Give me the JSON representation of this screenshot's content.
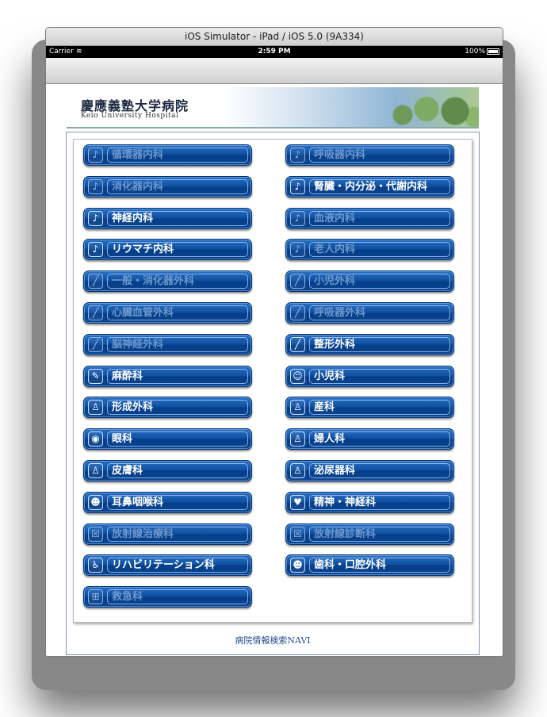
{
  "window": {
    "title": "iOS Simulator - iPad / iOS 5.0 (9A334)"
  },
  "statusbar": {
    "carrier": "Carrier",
    "time": "2:59 PM",
    "battery": "100%"
  },
  "logo": {
    "jp": "慶應義塾大学病院",
    "en": "Keio University Hospital"
  },
  "buttons": [
    {
      "label": "循環器内科",
      "icon": "stethoscope-icon",
      "glyph": "♪",
      "active": false
    },
    {
      "label": "呼吸器内科",
      "icon": "stethoscope-icon",
      "glyph": "♪",
      "active": false
    },
    {
      "label": "消化器内科",
      "icon": "stethoscope-icon",
      "glyph": "♪",
      "active": false
    },
    {
      "label": "腎臓・内分泌・代謝内科",
      "icon": "stethoscope-icon",
      "glyph": "♪",
      "active": true
    },
    {
      "label": "神経内科",
      "icon": "stethoscope-icon",
      "glyph": "♪",
      "active": true
    },
    {
      "label": "血液内科",
      "icon": "stethoscope-icon",
      "glyph": "♪",
      "active": false
    },
    {
      "label": "リウマチ内科",
      "icon": "stethoscope-icon",
      "glyph": "♪",
      "active": true
    },
    {
      "label": "老人内科",
      "icon": "stethoscope-icon",
      "glyph": "♪",
      "active": false
    },
    {
      "label": "一般・消化器外科",
      "icon": "scalpel-icon",
      "glyph": "╱",
      "active": false
    },
    {
      "label": "小児外科",
      "icon": "scalpel-icon",
      "glyph": "╱",
      "active": false
    },
    {
      "label": "心臓血管外科",
      "icon": "scalpel-icon",
      "glyph": "╱",
      "active": false
    },
    {
      "label": "呼吸器外科",
      "icon": "scalpel-icon",
      "glyph": "╱",
      "active": false
    },
    {
      "label": "脳神経外科",
      "icon": "scalpel-icon",
      "glyph": "╱",
      "active": false
    },
    {
      "label": "整形外科",
      "icon": "scalpel-icon",
      "glyph": "╱",
      "active": true
    },
    {
      "label": "麻酔科",
      "icon": "syringe-icon",
      "glyph": "✎",
      "active": true
    },
    {
      "label": "小児科",
      "icon": "parent-child-icon",
      "glyph": "☺",
      "active": true
    },
    {
      "label": "形成外科",
      "icon": "person-icon",
      "glyph": "♙",
      "active": true
    },
    {
      "label": "産科",
      "icon": "pregnant-woman-icon",
      "glyph": "♙",
      "active": true
    },
    {
      "label": "眼科",
      "icon": "eye-face-icon",
      "glyph": "◉",
      "active": true
    },
    {
      "label": "婦人科",
      "icon": "woman-icon",
      "glyph": "♙",
      "active": true
    },
    {
      "label": "皮膚科",
      "icon": "person-icon",
      "glyph": "♙",
      "active": true
    },
    {
      "label": "泌尿器科",
      "icon": "person-icon",
      "glyph": "♙",
      "active": true
    },
    {
      "label": "耳鼻咽喉科",
      "icon": "face-icon",
      "glyph": "☻",
      "active": true
    },
    {
      "label": "精神・神経科",
      "icon": "heart-icon",
      "glyph": "♥",
      "active": true
    },
    {
      "label": "放射線治療科",
      "icon": "xray-icon",
      "glyph": "☒",
      "active": false
    },
    {
      "label": "放射線診断科",
      "icon": "xray-icon",
      "glyph": "☒",
      "active": false
    },
    {
      "label": "リハビリテーション科",
      "icon": "walker-icon",
      "glyph": "♿",
      "active": true
    },
    {
      "label": "歯科・口腔外科",
      "icon": "face-icon",
      "glyph": "☻",
      "active": true
    },
    {
      "label": "救急科",
      "icon": "ambulance-icon",
      "glyph": "⊞",
      "active": false
    }
  ],
  "footer": {
    "text": "病院情報検索NAVI"
  }
}
